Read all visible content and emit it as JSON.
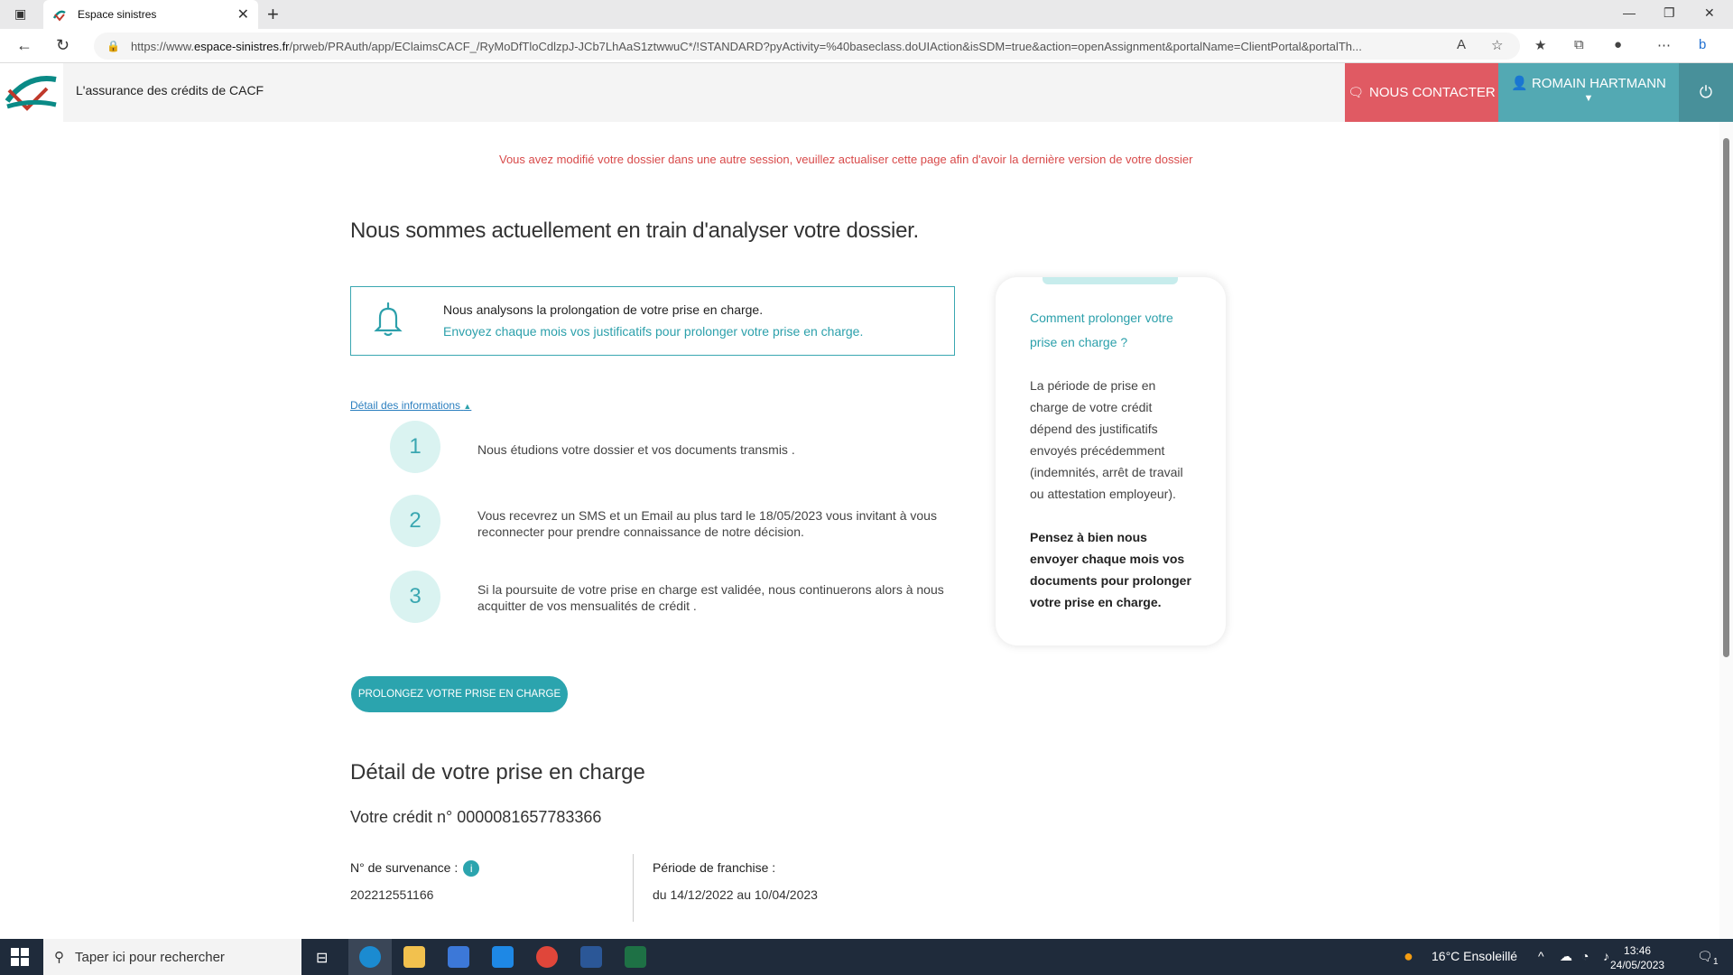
{
  "browser": {
    "tab_title": "Espace sinistres",
    "url_prefix": "https://www.",
    "url_host": "espace-sinistres.fr",
    "url_rest": "/prweb/PRAuth/app/EClaimsCACF_/RyMoDfTloCdlzpJ-JCb7LhAaS1ztwwuC*/!STANDARD?pyActivity=%40baseclass.doUIAction&isSDM=true&action=openAssignment&portalName=ClientPortal&portalTh..."
  },
  "header": {
    "brand": "L'assurance des crédits de CACF",
    "contact_label": "NOUS CONTACTER",
    "user_name": "ROMAIN HARTMANN"
  },
  "warning": "Vous avez modifié votre dossier dans une autre session, veuillez actualiser cette page afin d'avoir la dernière version de votre dossier",
  "main": {
    "title": "Nous sommes actuellement en train d'analyser votre dossier.",
    "notice_title": "Nous analysons la prolongation de votre prise en charge.",
    "notice_text": "Envoyez chaque mois vos justificatifs pour prolonger votre prise en charge.",
    "detail_link": "Détail des informations",
    "steps": [
      {
        "num": "1",
        "text": "Nous étudions votre dossier et vos documents transmis ."
      },
      {
        "num": "2",
        "text": "Vous recevrez un SMS et un Email au plus tard le 18/05/2023 vous invitant à vous reconnecter pour prendre connaissance de notre décision."
      },
      {
        "num": "3",
        "text": "Si la poursuite de votre prise en charge est validée, nous continuerons alors à nous acquitter de vos mensualités de crédit ."
      }
    ],
    "cta_label": "PROLONGEZ VOTRE PRISE EN CHARGE",
    "section_title": "Détail de votre prise en charge",
    "credit_line": "Votre crédit n° 0000081657783366",
    "survenance_label": "N° de survenance :",
    "survenance_value": "202212551166",
    "franchise_label": "Période de franchise :",
    "franchise_value": "du 14/12/2022  au 10/04/2023"
  },
  "side_card": {
    "title": "Comment prolonger votre prise en charge ?",
    "body": "La période de prise en charge de votre crédit dépend des justificatifs envoyés précédemment (indemnités, arrêt de travail ou attestation employeur).",
    "strong": "Pensez à bien nous envoyer chaque mois vos documents pour prolonger votre prise en charge."
  },
  "taskbar": {
    "search_placeholder": "Taper ici pour rechercher",
    "weather": "16°C  Ensoleillé",
    "time": "13:46",
    "date": "24/05/2023",
    "notif_count": "1"
  },
  "colors": {
    "teal": "#2ba4ae",
    "contact_red": "#e05a63",
    "user_teal": "#53a9b3",
    "warning_red": "#d84a4a"
  }
}
